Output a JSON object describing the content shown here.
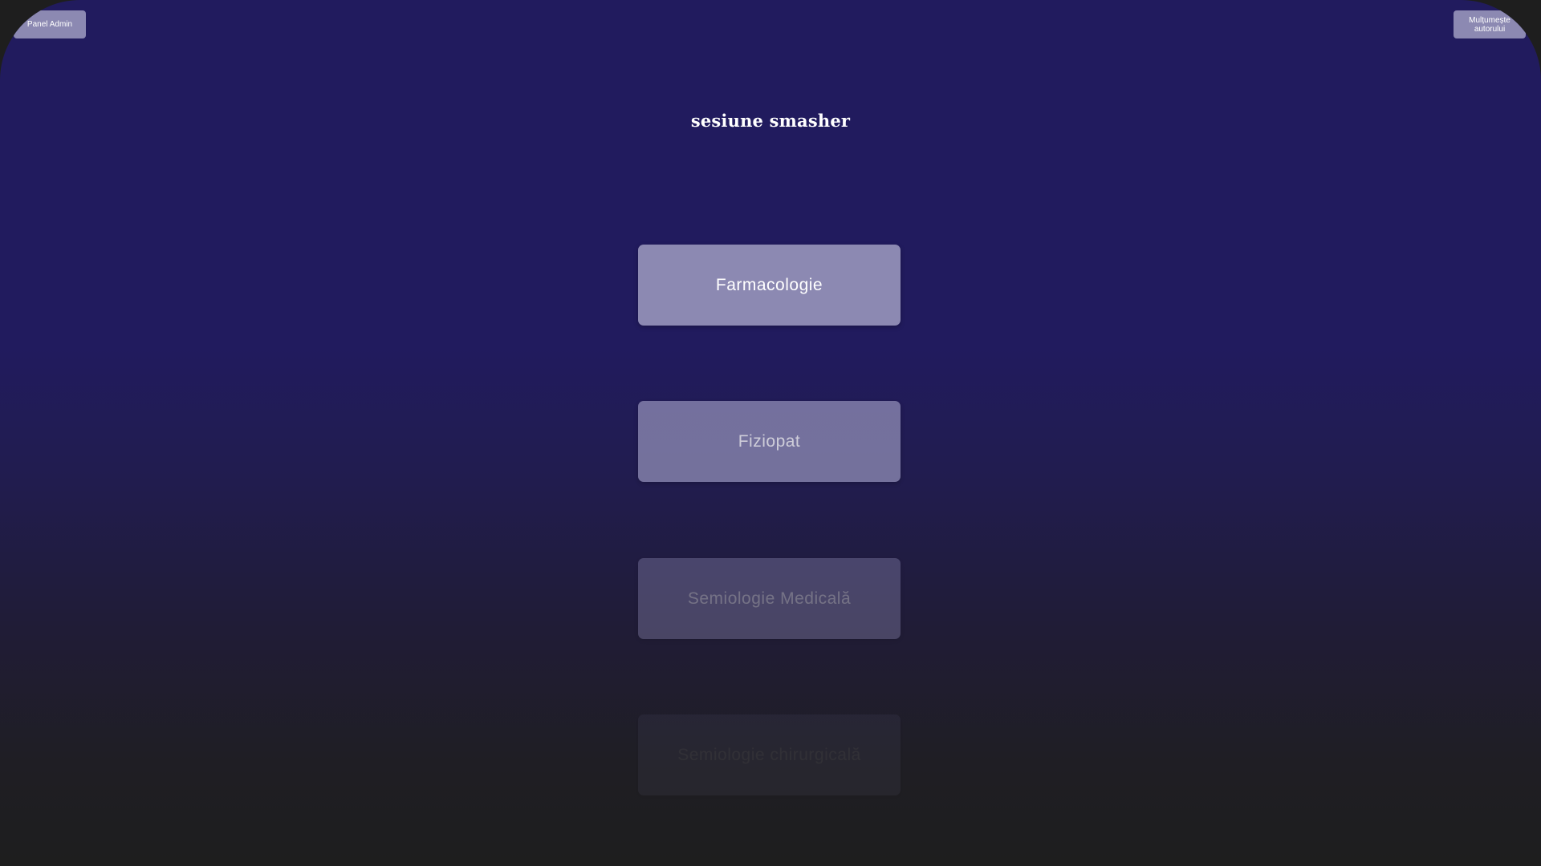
{
  "header": {
    "admin_label": "Panel Admin",
    "thanks_label": "Mulțumește\nautorului",
    "title": "sesiune smasher"
  },
  "subjects": [
    {
      "label": "Farmacologie"
    },
    {
      "label": "Fiziopat"
    },
    {
      "label": "Semiologie Medicală"
    },
    {
      "label": "Semiologie chirurgicală"
    }
  ],
  "colors": {
    "background_top": "#211b5e",
    "background_bottom": "#1e1e1e",
    "button": "#8c89b2",
    "text": "#ffffff"
  }
}
